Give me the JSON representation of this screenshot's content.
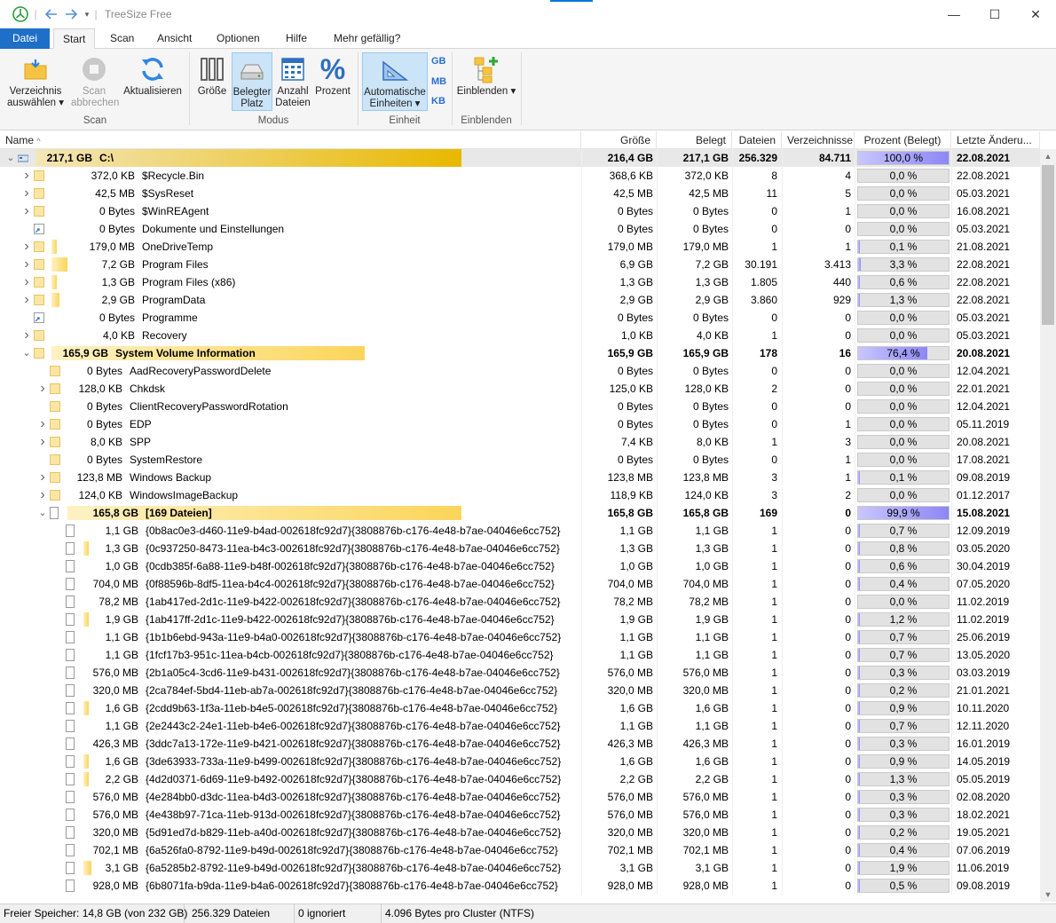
{
  "titlebar": {
    "app_title": "TreeSize Free",
    "minimize": "—",
    "maximize": "☐",
    "close": "✕"
  },
  "menu": {
    "tabs": [
      "Datei",
      "Start",
      "Scan",
      "Ansicht",
      "Optionen",
      "Hilfe",
      "Mehr gefällig?"
    ]
  },
  "ribbon": {
    "select_dir": "Verzeichnis auswählen ▾",
    "stop_scan": "Scan abbrechen",
    "refresh": "Aktualisieren",
    "group_scan": "Scan",
    "size": "Größe",
    "allocated": "Belegter Platz",
    "file_count": "Anzahl Dateien",
    "percent": "Prozent",
    "group_mode": "Modus",
    "auto_units": "Automatische Einheiten ▾",
    "unit_gb": "GB",
    "unit_mb": "MB",
    "unit_kb": "KB",
    "group_unit": "Einheit",
    "show": "Einblenden ▾",
    "group_show": "Einblenden"
  },
  "columns": [
    "Name",
    "Größe",
    "Belegt",
    "Dateien",
    "Verzeichnisse",
    "Prozent (Belegt)",
    "Letzte Änderu..."
  ],
  "rows": [
    {
      "indent": 0,
      "exp": "v",
      "type": "drive",
      "sz": "217,1 GB",
      "name": "C:\\",
      "size": "216,4 GB",
      "alloc": "217,1 GB",
      "files": "256.329",
      "dirs": "84.711",
      "pct": "100,0 %",
      "p": 100,
      "date": "22.08.2021",
      "bar": 1.0,
      "bold": true,
      "root": true
    },
    {
      "indent": 1,
      "exp": ">",
      "type": "folder",
      "sz": "372,0 KB",
      "name": "$Recycle.Bin",
      "size": "368,6 KB",
      "alloc": "372,0 KB",
      "files": "8",
      "dirs": "4",
      "pct": "0,0 %",
      "p": 0,
      "date": "22.08.2021",
      "bar": 0
    },
    {
      "indent": 1,
      "exp": ">",
      "type": "folder",
      "sz": "42,5 MB",
      "name": "$SysReset",
      "size": "42,5 MB",
      "alloc": "42,5 MB",
      "files": "11",
      "dirs": "5",
      "pct": "0,0 %",
      "p": 0,
      "date": "05.03.2021",
      "bar": 0
    },
    {
      "indent": 1,
      "exp": ">",
      "type": "folder",
      "sz": "0 Bytes",
      "name": "$WinREAgent",
      "size": "0 Bytes",
      "alloc": "0 Bytes",
      "files": "0",
      "dirs": "1",
      "pct": "0,0 %",
      "p": 0,
      "date": "16.08.2021",
      "bar": 0
    },
    {
      "indent": 1,
      "exp": "",
      "type": "link",
      "sz": "0 Bytes",
      "name": "Dokumente und Einstellungen",
      "size": "0 Bytes",
      "alloc": "0 Bytes",
      "files": "0",
      "dirs": "0",
      "pct": "0,0 %",
      "p": 0,
      "date": "05.03.2021",
      "bar": 0
    },
    {
      "indent": 1,
      "exp": ">",
      "type": "folder",
      "sz": "179,0 MB",
      "name": "OneDriveTemp",
      "size": "179,0 MB",
      "alloc": "179,0 MB",
      "files": "1",
      "dirs": "1",
      "pct": "0,1 %",
      "p": 0.1,
      "date": "21.08.2021",
      "bar": 0.01
    },
    {
      "indent": 1,
      "exp": ">",
      "type": "folder",
      "sz": "7,2 GB",
      "name": "Program Files",
      "size": "6,9 GB",
      "alloc": "7,2 GB",
      "files": "30.191",
      "dirs": "3.413",
      "pct": "3,3 %",
      "p": 3.3,
      "date": "22.08.2021",
      "bar": 0.04
    },
    {
      "indent": 1,
      "exp": ">",
      "type": "folder",
      "sz": "1,3 GB",
      "name": "Program Files (x86)",
      "size": "1,3 GB",
      "alloc": "1,3 GB",
      "files": "1.805",
      "dirs": "440",
      "pct": "0,6 %",
      "p": 0.6,
      "date": "22.08.2021",
      "bar": 0.01
    },
    {
      "indent": 1,
      "exp": ">",
      "type": "folder",
      "sz": "2,9 GB",
      "name": "ProgramData",
      "size": "2,9 GB",
      "alloc": "2,9 GB",
      "files": "3.860",
      "dirs": "929",
      "pct": "1,3 %",
      "p": 1.3,
      "date": "22.08.2021",
      "bar": 0.02
    },
    {
      "indent": 1,
      "exp": "",
      "type": "link",
      "sz": "0 Bytes",
      "name": "Programme",
      "size": "0 Bytes",
      "alloc": "0 Bytes",
      "files": "0",
      "dirs": "0",
      "pct": "0,0 %",
      "p": 0,
      "date": "05.03.2021",
      "bar": 0
    },
    {
      "indent": 1,
      "exp": ">",
      "type": "folder",
      "sz": "4,0 KB",
      "name": "Recovery",
      "size": "1,0 KB",
      "alloc": "4,0 KB",
      "files": "1",
      "dirs": "0",
      "pct": "0,0 %",
      "p": 0,
      "date": "05.03.2021",
      "bar": 0
    },
    {
      "indent": 1,
      "exp": "v",
      "type": "folder",
      "sz": "165,9 GB",
      "name": "System Volume Information",
      "size": "165,9 GB",
      "alloc": "165,9 GB",
      "files": "178",
      "dirs": "16",
      "pct": "76,4 %",
      "p": 76.4,
      "date": "20.08.2021",
      "bar": 0.764,
      "bold": true
    },
    {
      "indent": 2,
      "exp": "",
      "type": "folder",
      "sz": "0 Bytes",
      "name": "AadRecoveryPasswordDelete",
      "size": "0 Bytes",
      "alloc": "0 Bytes",
      "files": "0",
      "dirs": "0",
      "pct": "0,0 %",
      "p": 0,
      "date": "12.04.2021",
      "bar": 0
    },
    {
      "indent": 2,
      "exp": ">",
      "type": "folder",
      "sz": "128,0 KB",
      "name": "Chkdsk",
      "size": "125,0 KB",
      "alloc": "128,0 KB",
      "files": "2",
      "dirs": "0",
      "pct": "0,0 %",
      "p": 0,
      "date": "22.01.2021",
      "bar": 0
    },
    {
      "indent": 2,
      "exp": "",
      "type": "folder",
      "sz": "0 Bytes",
      "name": "ClientRecoveryPasswordRotation",
      "size": "0 Bytes",
      "alloc": "0 Bytes",
      "files": "0",
      "dirs": "0",
      "pct": "0,0 %",
      "p": 0,
      "date": "12.04.2021",
      "bar": 0
    },
    {
      "indent": 2,
      "exp": ">",
      "type": "folder",
      "sz": "0 Bytes",
      "name": "EDP",
      "size": "0 Bytes",
      "alloc": "0 Bytes",
      "files": "0",
      "dirs": "1",
      "pct": "0,0 %",
      "p": 0,
      "date": "05.11.2019",
      "bar": 0
    },
    {
      "indent": 2,
      "exp": ">",
      "type": "folder",
      "sz": "8,0 KB",
      "name": "SPP",
      "size": "7,4 KB",
      "alloc": "8,0 KB",
      "files": "1",
      "dirs": "3",
      "pct": "0,0 %",
      "p": 0,
      "date": "20.08.2021",
      "bar": 0
    },
    {
      "indent": 2,
      "exp": "",
      "type": "folder",
      "sz": "0 Bytes",
      "name": "SystemRestore",
      "size": "0 Bytes",
      "alloc": "0 Bytes",
      "files": "0",
      "dirs": "1",
      "pct": "0,0 %",
      "p": 0,
      "date": "17.08.2021",
      "bar": 0
    },
    {
      "indent": 2,
      "exp": ">",
      "type": "folder",
      "sz": "123,8 MB",
      "name": "Windows Backup",
      "size": "123,8 MB",
      "alloc": "123,8 MB",
      "files": "3",
      "dirs": "1",
      "pct": "0,1 %",
      "p": 0.1,
      "date": "09.08.2019",
      "bar": 0
    },
    {
      "indent": 2,
      "exp": ">",
      "type": "folder",
      "sz": "124,0 KB",
      "name": "WindowsImageBackup",
      "size": "118,9 KB",
      "alloc": "124,0 KB",
      "files": "3",
      "dirs": "2",
      "pct": "0,0 %",
      "p": 0,
      "date": "01.12.2017",
      "bar": 0
    },
    {
      "indent": 2,
      "exp": "v",
      "type": "file",
      "sz": "165,8 GB",
      "name": "[169 Dateien]",
      "size": "165,8 GB",
      "alloc": "165,8 GB",
      "files": "169",
      "dirs": "0",
      "pct": "99,9 %",
      "p": 99.9,
      "date": "15.08.2021",
      "bar": 0.999,
      "bold": true
    },
    {
      "indent": 3,
      "exp": "",
      "type": "file",
      "sz": "1,1 GB",
      "name": "{0b8ac0e3-d460-11e9-b4ad-002618fc92d7}{3808876b-c176-4e48-b7ae-04046e6cc752}",
      "size": "1,1 GB",
      "alloc": "1,1 GB",
      "files": "1",
      "dirs": "0",
      "pct": "0,7 %",
      "p": 0.7,
      "date": "12.09.2019",
      "bar": 0
    },
    {
      "indent": 3,
      "exp": "",
      "type": "file",
      "sz": "1,3 GB",
      "name": "{0c937250-8473-11ea-b4c3-002618fc92d7}{3808876b-c176-4e48-b7ae-04046e6cc752}",
      "size": "1,3 GB",
      "alloc": "1,3 GB",
      "files": "1",
      "dirs": "0",
      "pct": "0,8 %",
      "p": 0.8,
      "date": "03.05.2020",
      "bar": 0.01
    },
    {
      "indent": 3,
      "exp": "",
      "type": "file",
      "sz": "1,0 GB",
      "name": "{0cdb385f-6a88-11e9-b48f-002618fc92d7}{3808876b-c176-4e48-b7ae-04046e6cc752}",
      "size": "1,0 GB",
      "alloc": "1,0 GB",
      "files": "1",
      "dirs": "0",
      "pct": "0,6 %",
      "p": 0.6,
      "date": "30.04.2019",
      "bar": 0
    },
    {
      "indent": 3,
      "exp": "",
      "type": "file",
      "sz": "704,0 MB",
      "name": "{0f88596b-8df5-11ea-b4c4-002618fc92d7}{3808876b-c176-4e48-b7ae-04046e6cc752}",
      "size": "704,0 MB",
      "alloc": "704,0 MB",
      "files": "1",
      "dirs": "0",
      "pct": "0,4 %",
      "p": 0.4,
      "date": "07.05.2020",
      "bar": 0
    },
    {
      "indent": 3,
      "exp": "",
      "type": "file",
      "sz": "78,2 MB",
      "name": "{1ab417ed-2d1c-11e9-b422-002618fc92d7}{3808876b-c176-4e48-b7ae-04046e6cc752}",
      "size": "78,2 MB",
      "alloc": "78,2 MB",
      "files": "1",
      "dirs": "0",
      "pct": "0,0 %",
      "p": 0,
      "date": "11.02.2019",
      "bar": 0
    },
    {
      "indent": 3,
      "exp": "",
      "type": "file",
      "sz": "1,9 GB",
      "name": "{1ab417ff-2d1c-11e9-b422-002618fc92d7}{3808876b-c176-4e48-b7ae-04046e6cc752}",
      "size": "1,9 GB",
      "alloc": "1,9 GB",
      "files": "1",
      "dirs": "0",
      "pct": "1,2 %",
      "p": 1.2,
      "date": "11.02.2019",
      "bar": 0.01
    },
    {
      "indent": 3,
      "exp": "",
      "type": "file",
      "sz": "1,1 GB",
      "name": "{1b1b6ebd-943a-11e9-b4a0-002618fc92d7}{3808876b-c176-4e48-b7ae-04046e6cc752}",
      "size": "1,1 GB",
      "alloc": "1,1 GB",
      "files": "1",
      "dirs": "0",
      "pct": "0,7 %",
      "p": 0.7,
      "date": "25.06.2019",
      "bar": 0
    },
    {
      "indent": 3,
      "exp": "",
      "type": "file",
      "sz": "1,1 GB",
      "name": "{1fcf17b3-951c-11ea-b4cb-002618fc92d7}{3808876b-c176-4e48-b7ae-04046e6cc752}",
      "size": "1,1 GB",
      "alloc": "1,1 GB",
      "files": "1",
      "dirs": "0",
      "pct": "0,7 %",
      "p": 0.7,
      "date": "13.05.2020",
      "bar": 0
    },
    {
      "indent": 3,
      "exp": "",
      "type": "file",
      "sz": "576,0 MB",
      "name": "{2b1a05c4-3cd6-11e9-b431-002618fc92d7}{3808876b-c176-4e48-b7ae-04046e6cc752}",
      "size": "576,0 MB",
      "alloc": "576,0 MB",
      "files": "1",
      "dirs": "0",
      "pct": "0,3 %",
      "p": 0.3,
      "date": "03.03.2019",
      "bar": 0
    },
    {
      "indent": 3,
      "exp": "",
      "type": "file",
      "sz": "320,0 MB",
      "name": "{2ca784ef-5bd4-11eb-ab7a-002618fc92d7}{3808876b-c176-4e48-b7ae-04046e6cc752}",
      "size": "320,0 MB",
      "alloc": "320,0 MB",
      "files": "1",
      "dirs": "0",
      "pct": "0,2 %",
      "p": 0.2,
      "date": "21.01.2021",
      "bar": 0
    },
    {
      "indent": 3,
      "exp": "",
      "type": "file",
      "sz": "1,6 GB",
      "name": "{2cdd9b63-1f3a-11eb-b4e5-002618fc92d7}{3808876b-c176-4e48-b7ae-04046e6cc752}",
      "size": "1,6 GB",
      "alloc": "1,6 GB",
      "files": "1",
      "dirs": "0",
      "pct": "0,9 %",
      "p": 0.9,
      "date": "10.11.2020",
      "bar": 0.01
    },
    {
      "indent": 3,
      "exp": "",
      "type": "file",
      "sz": "1,1 GB",
      "name": "{2e2443c2-24e1-11eb-b4e6-002618fc92d7}{3808876b-c176-4e48-b7ae-04046e6cc752}",
      "size": "1,1 GB",
      "alloc": "1,1 GB",
      "files": "1",
      "dirs": "0",
      "pct": "0,7 %",
      "p": 0.7,
      "date": "12.11.2020",
      "bar": 0
    },
    {
      "indent": 3,
      "exp": "",
      "type": "file",
      "sz": "426,3 MB",
      "name": "{3ddc7a13-172e-11e9-b421-002618fc92d7}{3808876b-c176-4e48-b7ae-04046e6cc752}",
      "size": "426,3 MB",
      "alloc": "426,3 MB",
      "files": "1",
      "dirs": "0",
      "pct": "0,3 %",
      "p": 0.3,
      "date": "16.01.2019",
      "bar": 0
    },
    {
      "indent": 3,
      "exp": "",
      "type": "file",
      "sz": "1,6 GB",
      "name": "{3de63933-733a-11e9-b499-002618fc92d7}{3808876b-c176-4e48-b7ae-04046e6cc752}",
      "size": "1,6 GB",
      "alloc": "1,6 GB",
      "files": "1",
      "dirs": "0",
      "pct": "0,9 %",
      "p": 0.9,
      "date": "14.05.2019",
      "bar": 0.01
    },
    {
      "indent": 3,
      "exp": "",
      "type": "file",
      "sz": "2,2 GB",
      "name": "{4d2d0371-6d69-11e9-b492-002618fc92d7}{3808876b-c176-4e48-b7ae-04046e6cc752}",
      "size": "2,2 GB",
      "alloc": "2,2 GB",
      "files": "1",
      "dirs": "0",
      "pct": "1,3 %",
      "p": 1.3,
      "date": "05.05.2019",
      "bar": 0.01
    },
    {
      "indent": 3,
      "exp": "",
      "type": "file",
      "sz": "576,0 MB",
      "name": "{4e284bb0-d3dc-11ea-b4d3-002618fc92d7}{3808876b-c176-4e48-b7ae-04046e6cc752}",
      "size": "576,0 MB",
      "alloc": "576,0 MB",
      "files": "1",
      "dirs": "0",
      "pct": "0,3 %",
      "p": 0.3,
      "date": "02.08.2020",
      "bar": 0
    },
    {
      "indent": 3,
      "exp": "",
      "type": "file",
      "sz": "576,0 MB",
      "name": "{4e438b97-71ca-11eb-913d-002618fc92d7}{3808876b-c176-4e48-b7ae-04046e6cc752}",
      "size": "576,0 MB",
      "alloc": "576,0 MB",
      "files": "1",
      "dirs": "0",
      "pct": "0,3 %",
      "p": 0.3,
      "date": "18.02.2021",
      "bar": 0
    },
    {
      "indent": 3,
      "exp": "",
      "type": "file",
      "sz": "320,0 MB",
      "name": "{5d91ed7d-b829-11eb-a40d-002618fc92d7}{3808876b-c176-4e48-b7ae-04046e6cc752}",
      "size": "320,0 MB",
      "alloc": "320,0 MB",
      "files": "1",
      "dirs": "0",
      "pct": "0,2 %",
      "p": 0.2,
      "date": "19.05.2021",
      "bar": 0
    },
    {
      "indent": 3,
      "exp": "",
      "type": "file",
      "sz": "702,1 MB",
      "name": "{6a526fa0-8792-11e9-b49d-002618fc92d7}{3808876b-c176-4e48-b7ae-04046e6cc752}",
      "size": "702,1 MB",
      "alloc": "702,1 MB",
      "files": "1",
      "dirs": "0",
      "pct": "0,4 %",
      "p": 0.4,
      "date": "07.06.2019",
      "bar": 0
    },
    {
      "indent": 3,
      "exp": "",
      "type": "file",
      "sz": "3,1 GB",
      "name": "{6a5285b2-8792-11e9-b49d-002618fc92d7}{3808876b-c176-4e48-b7ae-04046e6cc752}",
      "size": "3,1 GB",
      "alloc": "3,1 GB",
      "files": "1",
      "dirs": "0",
      "pct": "1,9 %",
      "p": 1.9,
      "date": "11.06.2019",
      "bar": 0.02
    },
    {
      "indent": 3,
      "exp": "",
      "type": "file",
      "sz": "928,0 MB",
      "name": "{6b8071fa-b9da-11e9-b4a6-002618fc92d7}{3808876b-c176-4e48-b7ae-04046e6cc752}",
      "size": "928,0 MB",
      "alloc": "928,0 MB",
      "files": "1",
      "dirs": "0",
      "pct": "0,5 %",
      "p": 0.5,
      "date": "09.08.2019",
      "bar": 0
    }
  ],
  "status": {
    "free": "Freier Speicher: 14,8 GB  (von 232 GB)",
    "files": "256.329 Dateien",
    "ignored": "0 ignoriert",
    "cluster": "4.096 Bytes pro Cluster (NTFS)"
  },
  "colors": {
    "accent": "#0078d7",
    "file_tab": "#1e6fc7",
    "bar_gold": "#e8b800",
    "pct_fill": "#8d87f5"
  }
}
